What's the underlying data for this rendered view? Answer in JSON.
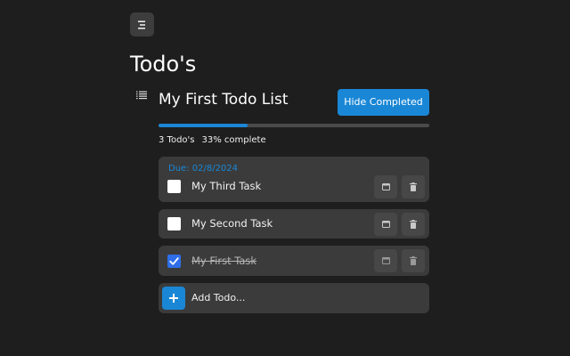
{
  "page": {
    "title": "Todo's"
  },
  "list": {
    "title": "My First Todo List",
    "hide_completed_label": "Hide Completed",
    "progress_fraction": 0.33,
    "count_text": "3 Todo's",
    "percent_text": "33% complete"
  },
  "todos": [
    {
      "due": "Due: 02/8/2024",
      "label": "My Third Task",
      "completed": false
    },
    {
      "due": "",
      "label": "My Second Task",
      "completed": false
    },
    {
      "due": "",
      "label": "My First Task",
      "completed": true
    }
  ],
  "add": {
    "placeholder": "Add Todo..."
  },
  "icons": {
    "menu": "menu-icon",
    "list": "list-icon",
    "calendar": "calendar-icon",
    "delete": "trash-icon",
    "add": "plus-icon",
    "check": "checkmark-icon"
  },
  "colors": {
    "background": "#1e1e1e",
    "card": "#3b3b3b",
    "accent": "#1a87d6",
    "checked": "#2f6ee8"
  }
}
